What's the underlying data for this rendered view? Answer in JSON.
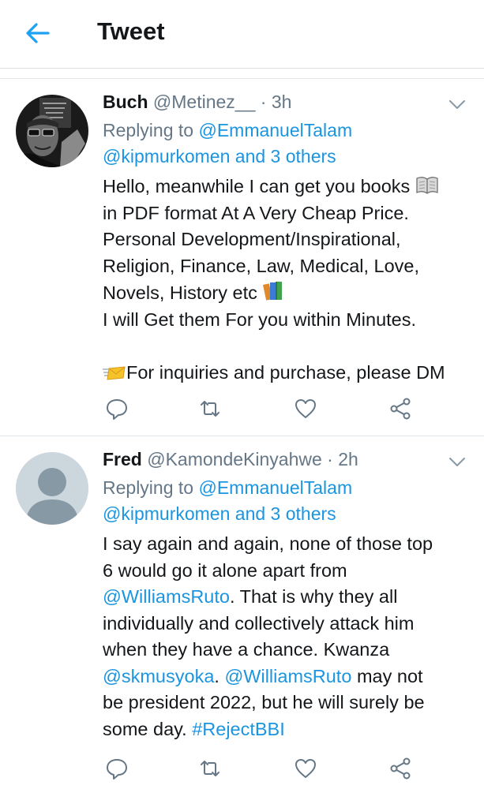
{
  "header": {
    "title": "Tweet",
    "back_icon": "arrow-left-icon",
    "accent": "#1da1f2"
  },
  "tweets": [
    {
      "name": "Buch",
      "handle": "@Metinez__",
      "dot": "·",
      "time": "3h",
      "reply_prefix": "Replying to",
      "reply_to_1": "@EmmanuelTalam",
      "reply_to_2": "@kipmurkomen and 3 others",
      "lines": [
        "Hello, meanwhile I can get you books",
        "in PDF format At A Very Cheap Price.",
        "Personal Development/Inspirational,",
        "Religion, Finance, Law, Medical, Love,",
        "Novels, History etc",
        "I will Get them For you within Minutes.",
        "For inquiries and purchase, please DM"
      ],
      "emoji_1": "open-book-icon",
      "emoji_2": "books-icon",
      "emoji_3": "envelope-with-arrow-icon"
    },
    {
      "name": "Fred",
      "handle": "@KamondeKinyahwe",
      "dot": "·",
      "time": "2h",
      "reply_prefix": "Replying to",
      "reply_to_1": "@EmmanuelTalam",
      "reply_to_2": "@kipmurkomen and 3 others",
      "body": {
        "l1": "I say again and again, none of those top",
        "l2": "6 would go it alone apart from",
        "l3_link": "@WilliamsRuto",
        "l3_text": ". That is why they all",
        "l4": "individually and collectively attack him",
        "l5": "when they have a chance. Kwanza",
        "l6_link1": "@skmusyoka",
        "l6_sep": ". ",
        "l6_link2": "@WilliamsRuto",
        "l6_text": " may not",
        "l7": "be president 2022, but he will surely be",
        "l8_text": "some day. ",
        "l8_link": "#RejectBBI"
      }
    }
  ],
  "colors": {
    "link": "#1b95e0",
    "muted": "#657786",
    "text": "#14171a",
    "divider": "#e1e6ea"
  }
}
